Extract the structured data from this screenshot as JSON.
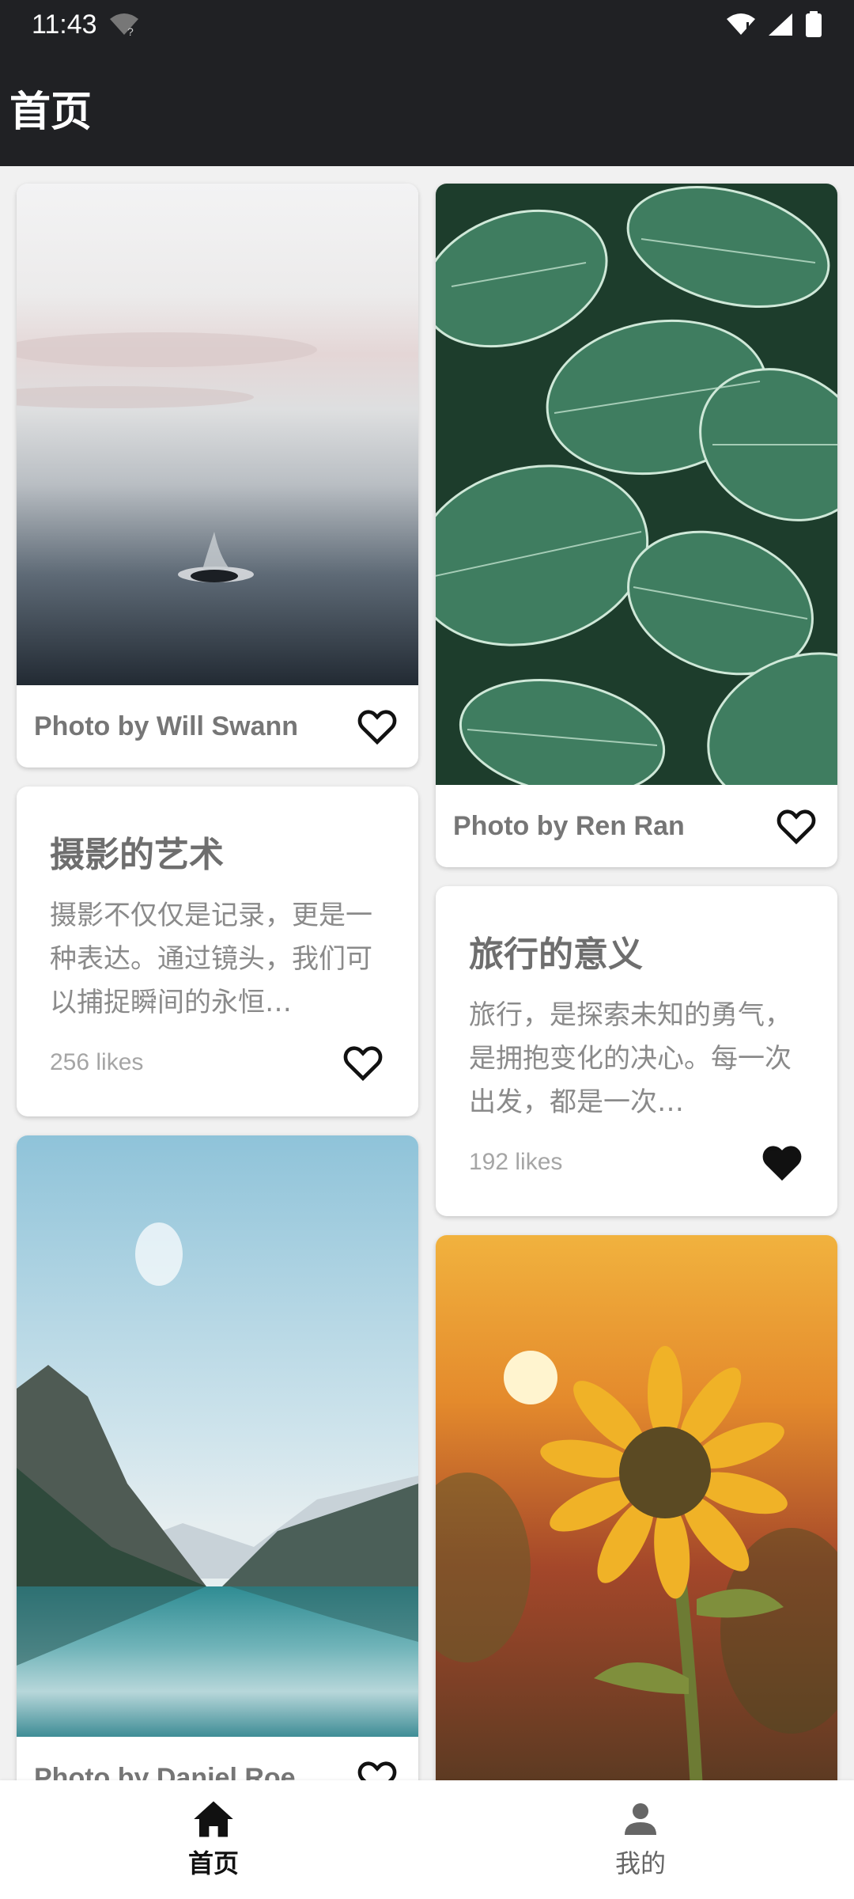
{
  "status_bar": {
    "time": "11:43"
  },
  "app_bar": {
    "title": "首页"
  },
  "feed": {
    "left": [
      {
        "type": "photo",
        "credit": "Photo by Will Swann",
        "liked": false
      },
      {
        "type": "article",
        "title": "摄影的艺术",
        "body": "摄影不仅仅是记录，更是一种表达。通过镜头，我们可以捕捉瞬间的永恒…",
        "likes": "256 likes",
        "liked": false
      },
      {
        "type": "photo",
        "credit": "Photo by Daniel Roe",
        "liked": false
      }
    ],
    "right": [
      {
        "type": "photo",
        "credit": "Photo by Ren Ran",
        "liked": false
      },
      {
        "type": "article",
        "title": "旅行的意义",
        "body": "旅行，是探索未知的勇气，是拥抱变化的决心。每一次出发，都是一次…",
        "likes": "192 likes",
        "liked": true
      },
      {
        "type": "photo",
        "credit": "",
        "liked": false
      }
    ]
  },
  "bottom_nav": {
    "items": [
      {
        "label": "首页",
        "icon": "home-icon",
        "active": true
      },
      {
        "label": "我的",
        "icon": "person-icon",
        "active": false
      }
    ]
  }
}
